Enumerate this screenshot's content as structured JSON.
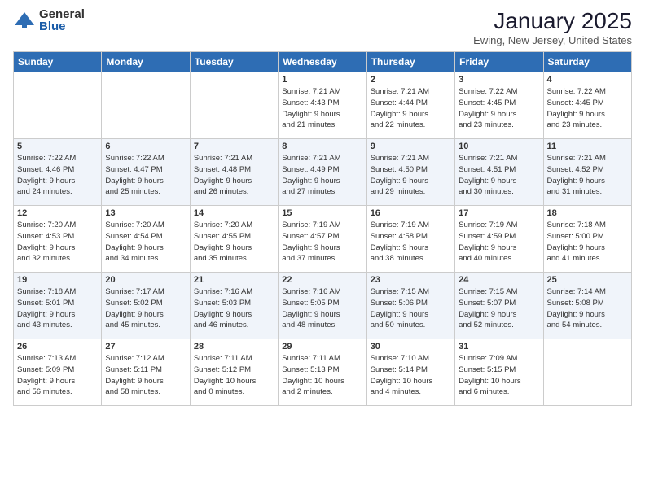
{
  "logo": {
    "general": "General",
    "blue": "Blue"
  },
  "header": {
    "month": "January 2025",
    "location": "Ewing, New Jersey, United States"
  },
  "days_of_week": [
    "Sunday",
    "Monday",
    "Tuesday",
    "Wednesday",
    "Thursday",
    "Friday",
    "Saturday"
  ],
  "weeks": [
    [
      {
        "day": "",
        "info": ""
      },
      {
        "day": "",
        "info": ""
      },
      {
        "day": "",
        "info": ""
      },
      {
        "day": "1",
        "info": "Sunrise: 7:21 AM\nSunset: 4:43 PM\nDaylight: 9 hours\nand 21 minutes."
      },
      {
        "day": "2",
        "info": "Sunrise: 7:21 AM\nSunset: 4:44 PM\nDaylight: 9 hours\nand 22 minutes."
      },
      {
        "day": "3",
        "info": "Sunrise: 7:22 AM\nSunset: 4:45 PM\nDaylight: 9 hours\nand 23 minutes."
      },
      {
        "day": "4",
        "info": "Sunrise: 7:22 AM\nSunset: 4:45 PM\nDaylight: 9 hours\nand 23 minutes."
      }
    ],
    [
      {
        "day": "5",
        "info": "Sunrise: 7:22 AM\nSunset: 4:46 PM\nDaylight: 9 hours\nand 24 minutes."
      },
      {
        "day": "6",
        "info": "Sunrise: 7:22 AM\nSunset: 4:47 PM\nDaylight: 9 hours\nand 25 minutes."
      },
      {
        "day": "7",
        "info": "Sunrise: 7:21 AM\nSunset: 4:48 PM\nDaylight: 9 hours\nand 26 minutes."
      },
      {
        "day": "8",
        "info": "Sunrise: 7:21 AM\nSunset: 4:49 PM\nDaylight: 9 hours\nand 27 minutes."
      },
      {
        "day": "9",
        "info": "Sunrise: 7:21 AM\nSunset: 4:50 PM\nDaylight: 9 hours\nand 29 minutes."
      },
      {
        "day": "10",
        "info": "Sunrise: 7:21 AM\nSunset: 4:51 PM\nDaylight: 9 hours\nand 30 minutes."
      },
      {
        "day": "11",
        "info": "Sunrise: 7:21 AM\nSunset: 4:52 PM\nDaylight: 9 hours\nand 31 minutes."
      }
    ],
    [
      {
        "day": "12",
        "info": "Sunrise: 7:20 AM\nSunset: 4:53 PM\nDaylight: 9 hours\nand 32 minutes."
      },
      {
        "day": "13",
        "info": "Sunrise: 7:20 AM\nSunset: 4:54 PM\nDaylight: 9 hours\nand 34 minutes."
      },
      {
        "day": "14",
        "info": "Sunrise: 7:20 AM\nSunset: 4:55 PM\nDaylight: 9 hours\nand 35 minutes."
      },
      {
        "day": "15",
        "info": "Sunrise: 7:19 AM\nSunset: 4:57 PM\nDaylight: 9 hours\nand 37 minutes."
      },
      {
        "day": "16",
        "info": "Sunrise: 7:19 AM\nSunset: 4:58 PM\nDaylight: 9 hours\nand 38 minutes."
      },
      {
        "day": "17",
        "info": "Sunrise: 7:19 AM\nSunset: 4:59 PM\nDaylight: 9 hours\nand 40 minutes."
      },
      {
        "day": "18",
        "info": "Sunrise: 7:18 AM\nSunset: 5:00 PM\nDaylight: 9 hours\nand 41 minutes."
      }
    ],
    [
      {
        "day": "19",
        "info": "Sunrise: 7:18 AM\nSunset: 5:01 PM\nDaylight: 9 hours\nand 43 minutes."
      },
      {
        "day": "20",
        "info": "Sunrise: 7:17 AM\nSunset: 5:02 PM\nDaylight: 9 hours\nand 45 minutes."
      },
      {
        "day": "21",
        "info": "Sunrise: 7:16 AM\nSunset: 5:03 PM\nDaylight: 9 hours\nand 46 minutes."
      },
      {
        "day": "22",
        "info": "Sunrise: 7:16 AM\nSunset: 5:05 PM\nDaylight: 9 hours\nand 48 minutes."
      },
      {
        "day": "23",
        "info": "Sunrise: 7:15 AM\nSunset: 5:06 PM\nDaylight: 9 hours\nand 50 minutes."
      },
      {
        "day": "24",
        "info": "Sunrise: 7:15 AM\nSunset: 5:07 PM\nDaylight: 9 hours\nand 52 minutes."
      },
      {
        "day": "25",
        "info": "Sunrise: 7:14 AM\nSunset: 5:08 PM\nDaylight: 9 hours\nand 54 minutes."
      }
    ],
    [
      {
        "day": "26",
        "info": "Sunrise: 7:13 AM\nSunset: 5:09 PM\nDaylight: 9 hours\nand 56 minutes."
      },
      {
        "day": "27",
        "info": "Sunrise: 7:12 AM\nSunset: 5:11 PM\nDaylight: 9 hours\nand 58 minutes."
      },
      {
        "day": "28",
        "info": "Sunrise: 7:11 AM\nSunset: 5:12 PM\nDaylight: 10 hours\nand 0 minutes."
      },
      {
        "day": "29",
        "info": "Sunrise: 7:11 AM\nSunset: 5:13 PM\nDaylight: 10 hours\nand 2 minutes."
      },
      {
        "day": "30",
        "info": "Sunrise: 7:10 AM\nSunset: 5:14 PM\nDaylight: 10 hours\nand 4 minutes."
      },
      {
        "day": "31",
        "info": "Sunrise: 7:09 AM\nSunset: 5:15 PM\nDaylight: 10 hours\nand 6 minutes."
      },
      {
        "day": "",
        "info": ""
      }
    ]
  ]
}
